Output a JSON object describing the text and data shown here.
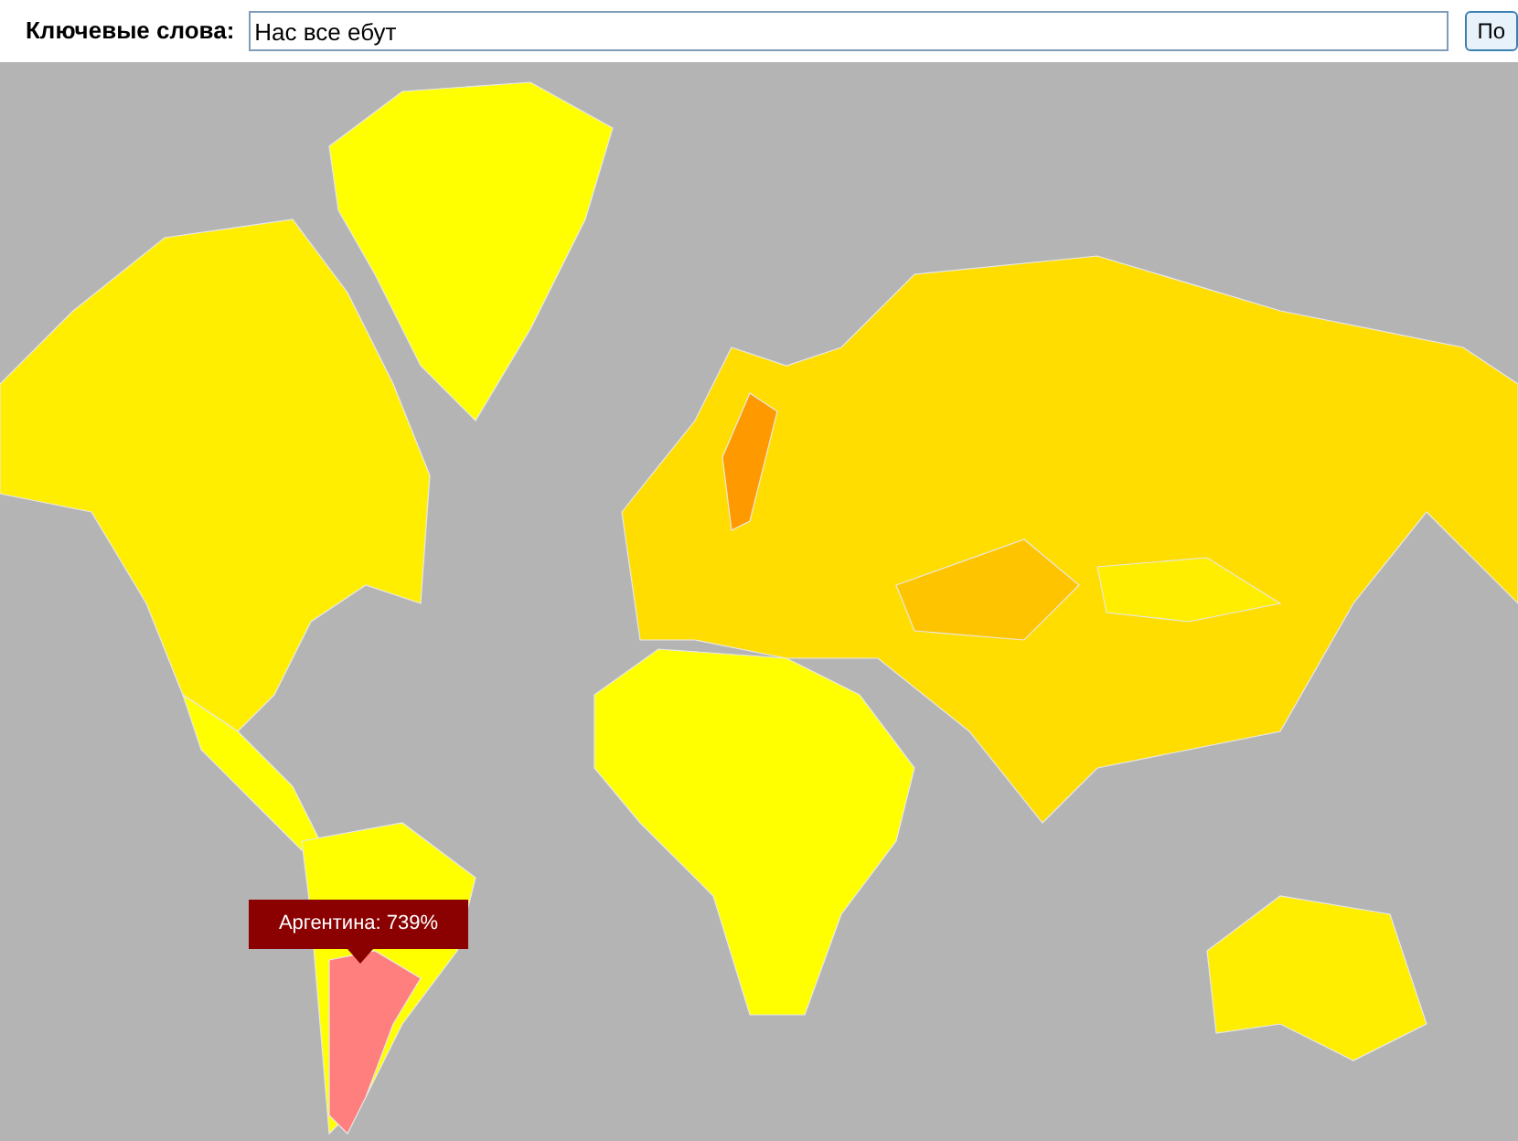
{
  "search": {
    "label": "Ключевые слова:",
    "value": "Нас все ебут",
    "button": "По"
  },
  "map": {
    "tooltip": "Аргентина: 739%"
  }
}
